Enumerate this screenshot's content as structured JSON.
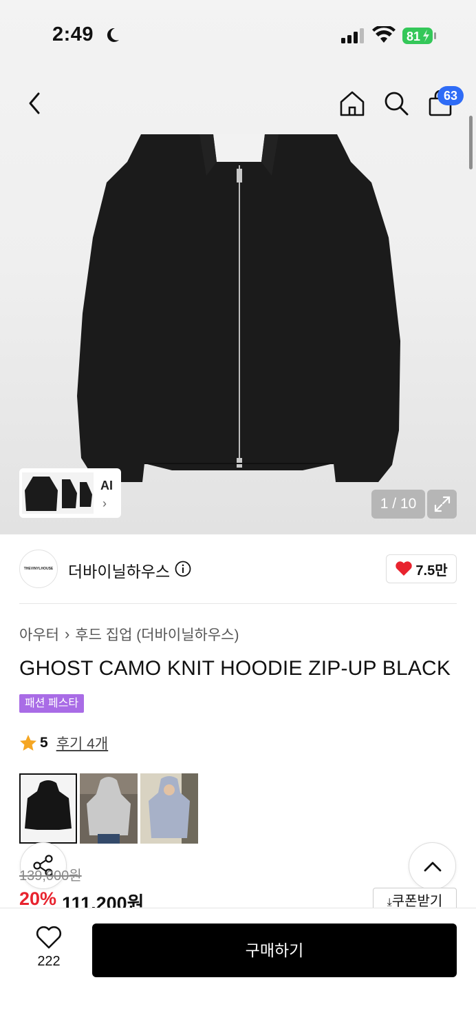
{
  "status_bar": {
    "time": "2:49",
    "battery": "81"
  },
  "header": {
    "cart_count": "63"
  },
  "gallery": {
    "counter": "1 / 10",
    "ai_label": "AI"
  },
  "brand": {
    "logo_text": "THEVINYLHOUSE",
    "name": "더바이닐하우스",
    "likes": "7.5만"
  },
  "breadcrumb": {
    "category": "아우터",
    "subcategory": "후드 집업 (더바이닐하우스)"
  },
  "product": {
    "title": "GHOST CAMO KNIT HOODIE ZIP-UP BLACK",
    "promo_tag": "패션 페스타",
    "rating": "5",
    "reviews": "후기 4개",
    "original_price": "139,000원",
    "discount": "20%",
    "price": "111,200원",
    "coupon_label": "쿠폰받기"
  },
  "bottom_bar": {
    "wish_count": "222",
    "buy_label": "구매하기"
  },
  "colors": {
    "accent_blue": "#2f6cf6",
    "discount_red": "#e8232e",
    "promo_purple": "#a96ce6",
    "battery_green": "#34c759"
  }
}
